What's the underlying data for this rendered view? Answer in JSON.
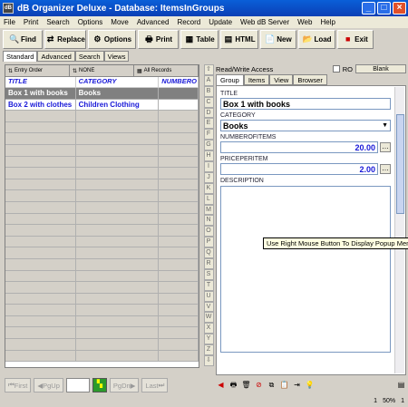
{
  "window": {
    "title": "dB Organizer Deluxe - Database: ItemsInGroups",
    "app_icon": "dB"
  },
  "menu": [
    "File",
    "Print",
    "Search",
    "Options",
    "Move",
    "Advanced",
    "Record",
    "Update",
    "Web dB Server",
    "Web",
    "Help"
  ],
  "toolbar": {
    "find": "Find",
    "replace": "Replace",
    "options": "Options",
    "print": "Print",
    "table": "Table",
    "html": "HTML",
    "new": "New",
    "load": "Load",
    "exit": "Exit"
  },
  "view_tabs": [
    "Standard",
    "Advanced",
    "Search",
    "Views"
  ],
  "sort_bar": {
    "order": "Entry Order",
    "group": "NONE",
    "records": "All Records"
  },
  "grid": {
    "columns": [
      "TITLE",
      "CATEGORY",
      "NUMBERO"
    ],
    "rows": [
      {
        "title": "Box 1 with books",
        "category": "Books"
      },
      {
        "title": "Box 2 with clothes",
        "category": "Children Clothing"
      }
    ]
  },
  "nav": {
    "first": "First",
    "pgup": "PgUp",
    "pgdn": "PgDn",
    "last": "Last"
  },
  "letters": [
    "A",
    "B",
    "C",
    "D",
    "E",
    "F",
    "G",
    "H",
    "I",
    "J",
    "K",
    "L",
    "M",
    "N",
    "O",
    "P",
    "Q",
    "R",
    "S",
    "T",
    "U",
    "V",
    "W",
    "X",
    "Y",
    "Z"
  ],
  "right": {
    "access": "Read/Write Access",
    "ro_label": "RO",
    "blank": "Blank",
    "tabs": [
      "Group",
      "Items",
      "View",
      "Browser"
    ],
    "fields": {
      "title_label": "TITLE",
      "title_value": "Box 1 with books",
      "category_label": "CATEGORY",
      "category_value": "Books",
      "number_label": "NUMBEROFITEMS",
      "number_value": "20.00",
      "price_label": "PRICEPERITEM",
      "price_value": "2.00",
      "desc_label": "DESCRIPTION"
    },
    "tooltip": "Use Right Mouse Button To Display Popup Menus"
  },
  "status": {
    "page": "1",
    "zoom": "50%",
    "count": "1"
  }
}
